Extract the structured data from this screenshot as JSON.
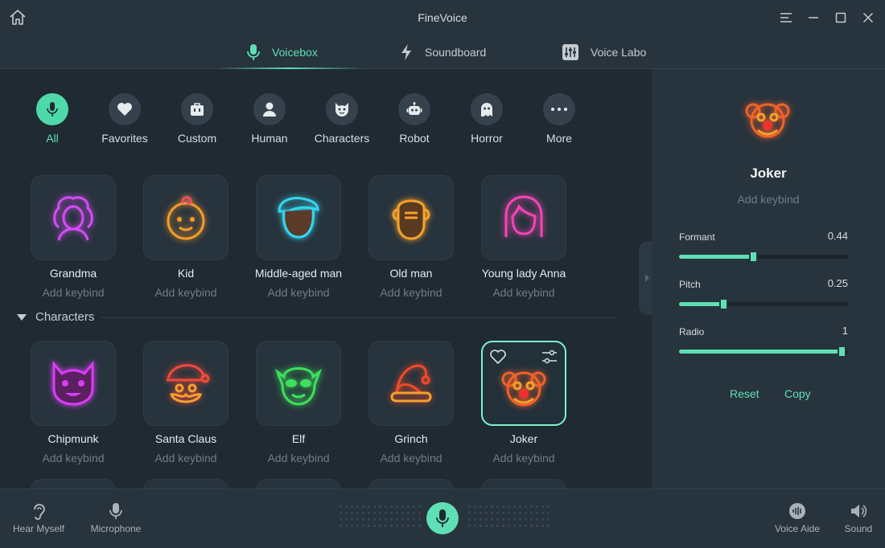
{
  "app": {
    "title": "FineVoice"
  },
  "tabs": [
    {
      "label": "Voicebox",
      "active": true,
      "icon": "microphone-icon"
    },
    {
      "label": "Soundboard",
      "active": false,
      "icon": "lightning-icon"
    },
    {
      "label": "Voice Labo",
      "active": false,
      "icon": "equalizer-icon"
    }
  ],
  "categories": [
    {
      "label": "All",
      "icon": "microphone-icon",
      "active": true
    },
    {
      "label": "Favorites",
      "icon": "heart-icon"
    },
    {
      "label": "Custom",
      "icon": "bag-icon"
    },
    {
      "label": "Human",
      "icon": "person-icon"
    },
    {
      "label": "Characters",
      "icon": "cat-face-icon"
    },
    {
      "label": "Robot",
      "icon": "robot-icon"
    },
    {
      "label": "Horror",
      "icon": "ghost-icon"
    },
    {
      "label": "More",
      "icon": "more-icon"
    }
  ],
  "human_voices": [
    {
      "name": "Grandma",
      "keybind": "Add keybind",
      "color": "#d34cf5"
    },
    {
      "name": "Kid",
      "keybind": "Add keybind",
      "color": "#f59a2b"
    },
    {
      "name": "Middle-aged man",
      "keybind": "Add keybind",
      "color": "#34d6f0"
    },
    {
      "name": "Old man",
      "keybind": "Add keybind",
      "color": "#f5a12b"
    },
    {
      "name": "Young lady Anna",
      "keybind": "Add keybind",
      "color": "#f545b6"
    }
  ],
  "section": {
    "label": "Characters"
  },
  "character_voices": [
    {
      "name": "Chipmunk",
      "keybind": "Add keybind",
      "color": "#d83df5"
    },
    {
      "name": "Santa Claus",
      "keybind": "Add keybind",
      "color": "#f04a3a"
    },
    {
      "name": "Elf",
      "keybind": "Add keybind",
      "color": "#3de05a"
    },
    {
      "name": "Grinch",
      "keybind": "Add keybind",
      "color": "#f04a2a"
    },
    {
      "name": "Joker",
      "keybind": "Add keybind",
      "color": "#f0622a",
      "selected": true
    }
  ],
  "panel": {
    "name": "Joker",
    "keybind": "Add keybind",
    "sliders": [
      {
        "label": "Formant",
        "value": "0.44",
        "fraction": 0.44
      },
      {
        "label": "Pitch",
        "value": "0.25",
        "fraction": 0.26
      },
      {
        "label": "Radio",
        "value": "1",
        "fraction": 0.96
      }
    ],
    "reset_label": "Reset",
    "copy_label": "Copy"
  },
  "bottom": {
    "hear_myself": "Hear Myself",
    "microphone": "Microphone",
    "voice_aide": "Voice Aide",
    "sound": "Sound"
  },
  "colors": {
    "accent": "#5ee0b4",
    "background": "#1f2a33",
    "panel": "#27333d"
  }
}
